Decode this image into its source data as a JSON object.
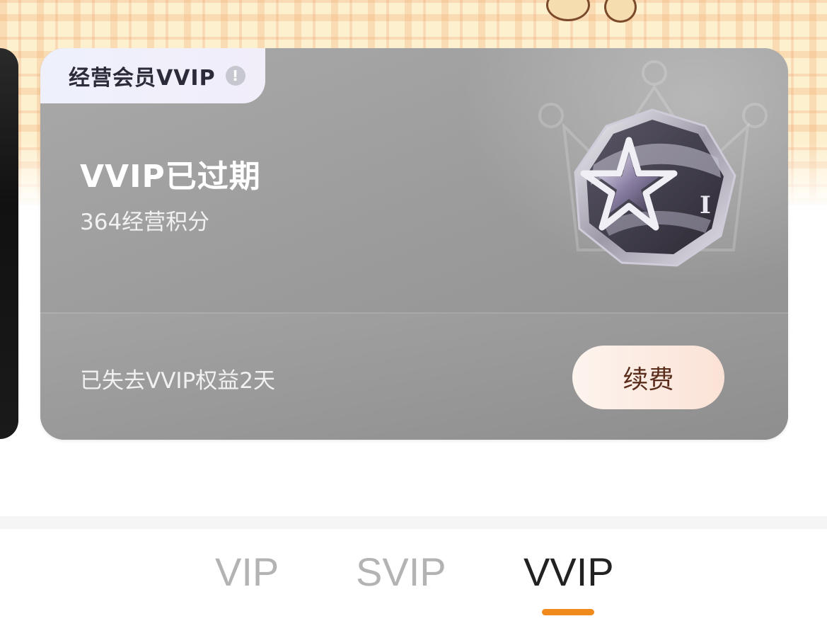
{
  "card": {
    "tag_label": "经营会员VVIP",
    "info_icon": "!",
    "status": "VVIP已过期",
    "points": "364经营积分",
    "lost_days": "已失去VVIP权益2天",
    "renew_label": "续费",
    "badge_level": "I"
  },
  "tabs": [
    {
      "label": "VIP",
      "active": false
    },
    {
      "label": "SVIP",
      "active": false
    },
    {
      "label": "VVIP",
      "active": true
    }
  ],
  "colors": {
    "accent": "#f08a1c",
    "card_gray": "#9c9c9c",
    "renew_bg": "#fbe2d6",
    "renew_text": "#5a2c1c"
  }
}
